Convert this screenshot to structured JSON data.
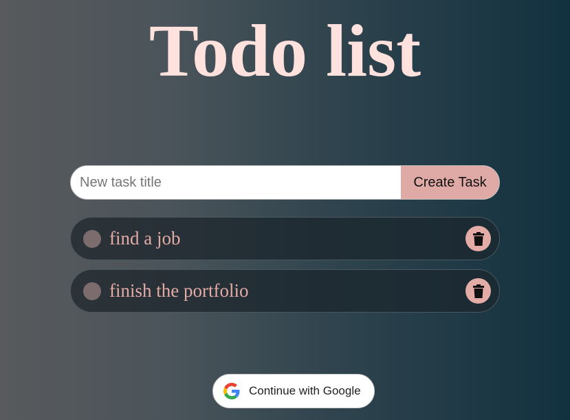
{
  "page": {
    "title": "Todo list"
  },
  "form": {
    "input_value": "",
    "input_placeholder": "New task title",
    "create_label": "Create Task"
  },
  "tasks": [
    {
      "title": "find a job",
      "completed": false
    },
    {
      "title": "finish the portfolio",
      "completed": false
    }
  ],
  "auth": {
    "google_label": "Continue with Google"
  },
  "icons": {
    "delete": "trash-icon",
    "google": "google-logo-icon",
    "check": "circle-checkbox-icon"
  },
  "colors": {
    "title": "#ffe1de",
    "accent": "#dfaaa5",
    "task_text": "#e4aba6",
    "checkbox": "#7d6c6d"
  }
}
